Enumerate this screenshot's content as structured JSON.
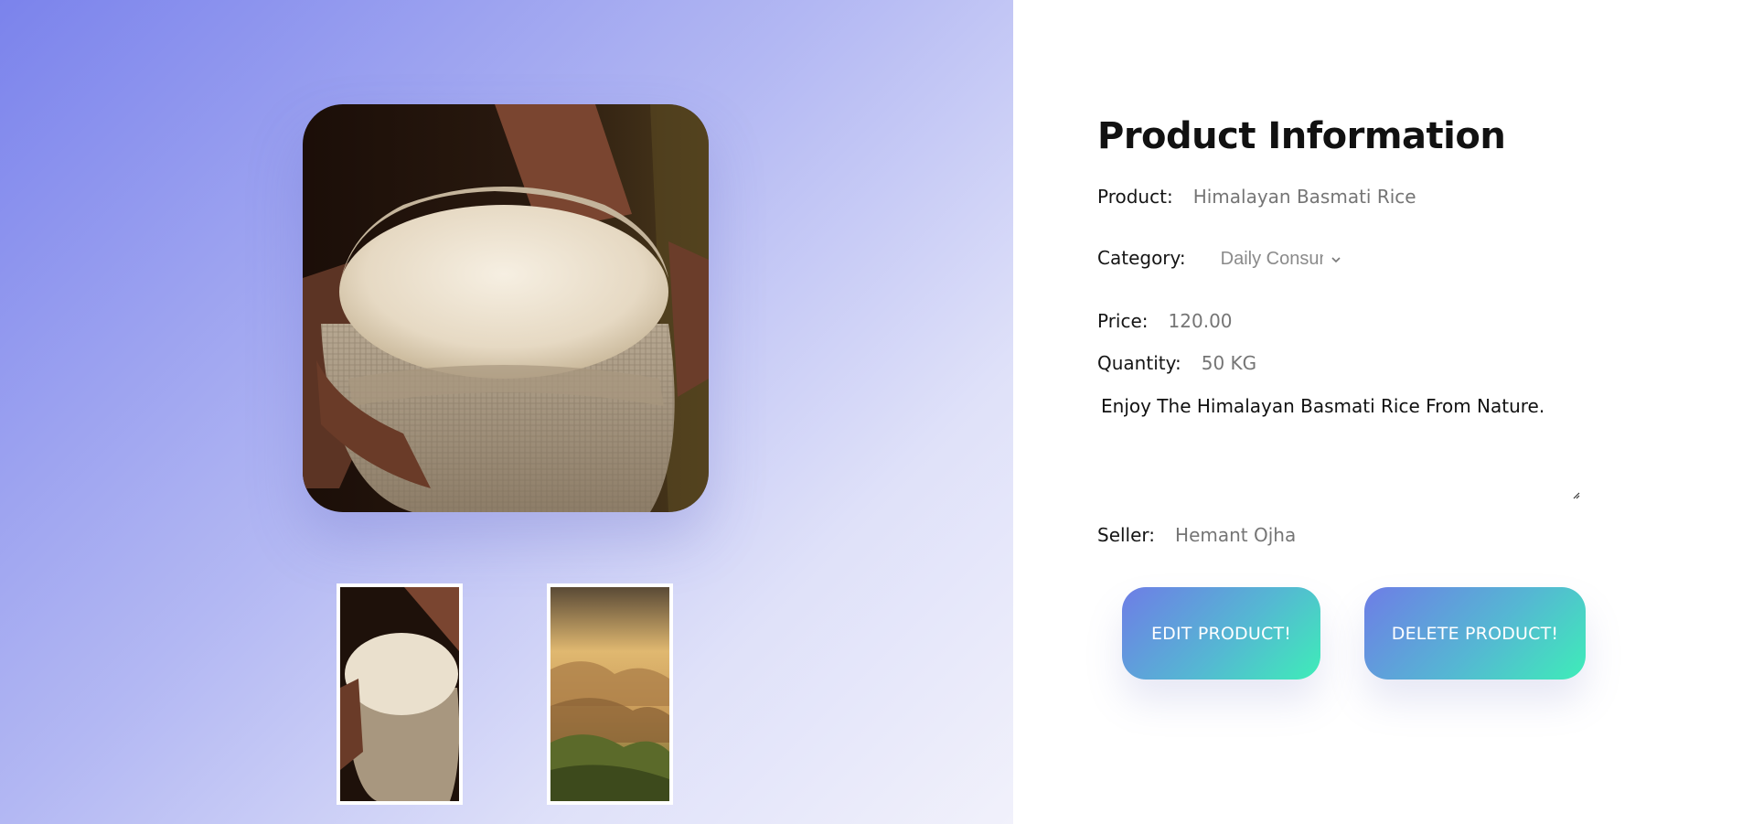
{
  "gallery": {
    "main_image_alt": "rice-sack-photo",
    "thumbnails": [
      {
        "icon": "rice-sack-thumbnail"
      },
      {
        "icon": "mountain-landscape-thumbnail"
      }
    ]
  },
  "info": {
    "title": "Product Information",
    "product_label": "Product:",
    "product_value": "Himalayan Basmati Rice",
    "category_label": "Category:",
    "category_value": "Daily Consumable",
    "price_label": "Price:",
    "price_value": "120.00",
    "quantity_label": "Quantity:",
    "quantity_value": "50 KG",
    "description": "Enjoy The Himalayan Basmati Rice From Nature.",
    "seller_label": "Seller:",
    "seller_value": "Hemant Ojha"
  },
  "actions": {
    "edit_label": "EDIT PRODUCT!",
    "delete_label": "DELETE PRODUCT!"
  },
  "colors": {
    "gradient_start": "#7b83ec",
    "gradient_end": "#f1f1fb",
    "button_start": "#6e7de6",
    "button_end": "#3eedb8"
  }
}
